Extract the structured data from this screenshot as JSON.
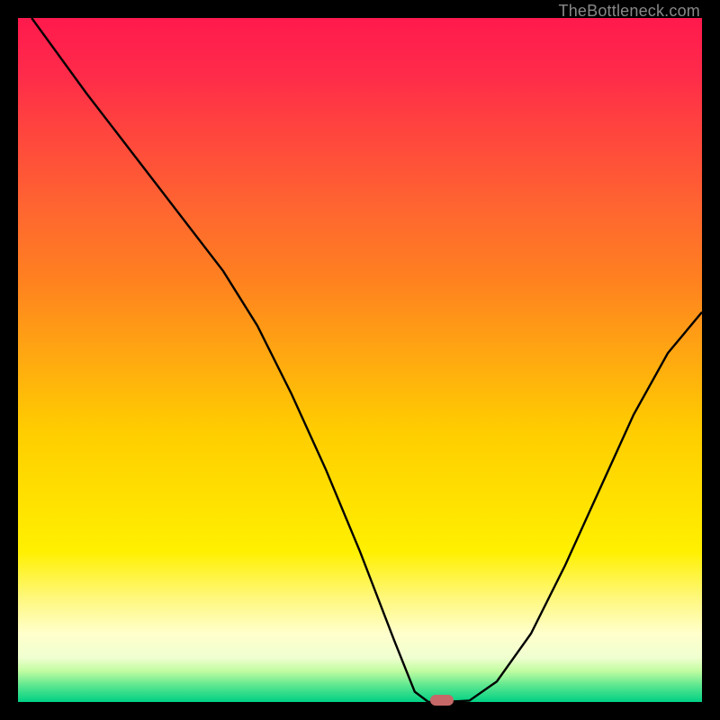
{
  "watermark": "TheBottleneck.com",
  "colors": {
    "background": "#000000",
    "curve_stroke": "#000000",
    "marker_fill": "#c76868"
  },
  "chart_data": {
    "type": "line",
    "title": "",
    "xlabel": "",
    "ylabel": "",
    "xlim": [
      0,
      100
    ],
    "ylim": [
      0,
      100
    ],
    "annotations": [
      {
        "name": "marker",
        "x": 62,
        "y": 0
      }
    ],
    "series": [
      {
        "name": "curve",
        "x": [
          2,
          10,
          20,
          30,
          35,
          40,
          45,
          50,
          55,
          58,
          60,
          62,
          66,
          70,
          75,
          80,
          85,
          90,
          95,
          100
        ],
        "y": [
          100,
          89,
          76,
          63,
          55,
          45,
          34,
          22,
          9,
          1.5,
          0,
          0,
          0.2,
          3,
          10,
          20,
          31,
          42,
          51,
          57
        ]
      }
    ]
  }
}
